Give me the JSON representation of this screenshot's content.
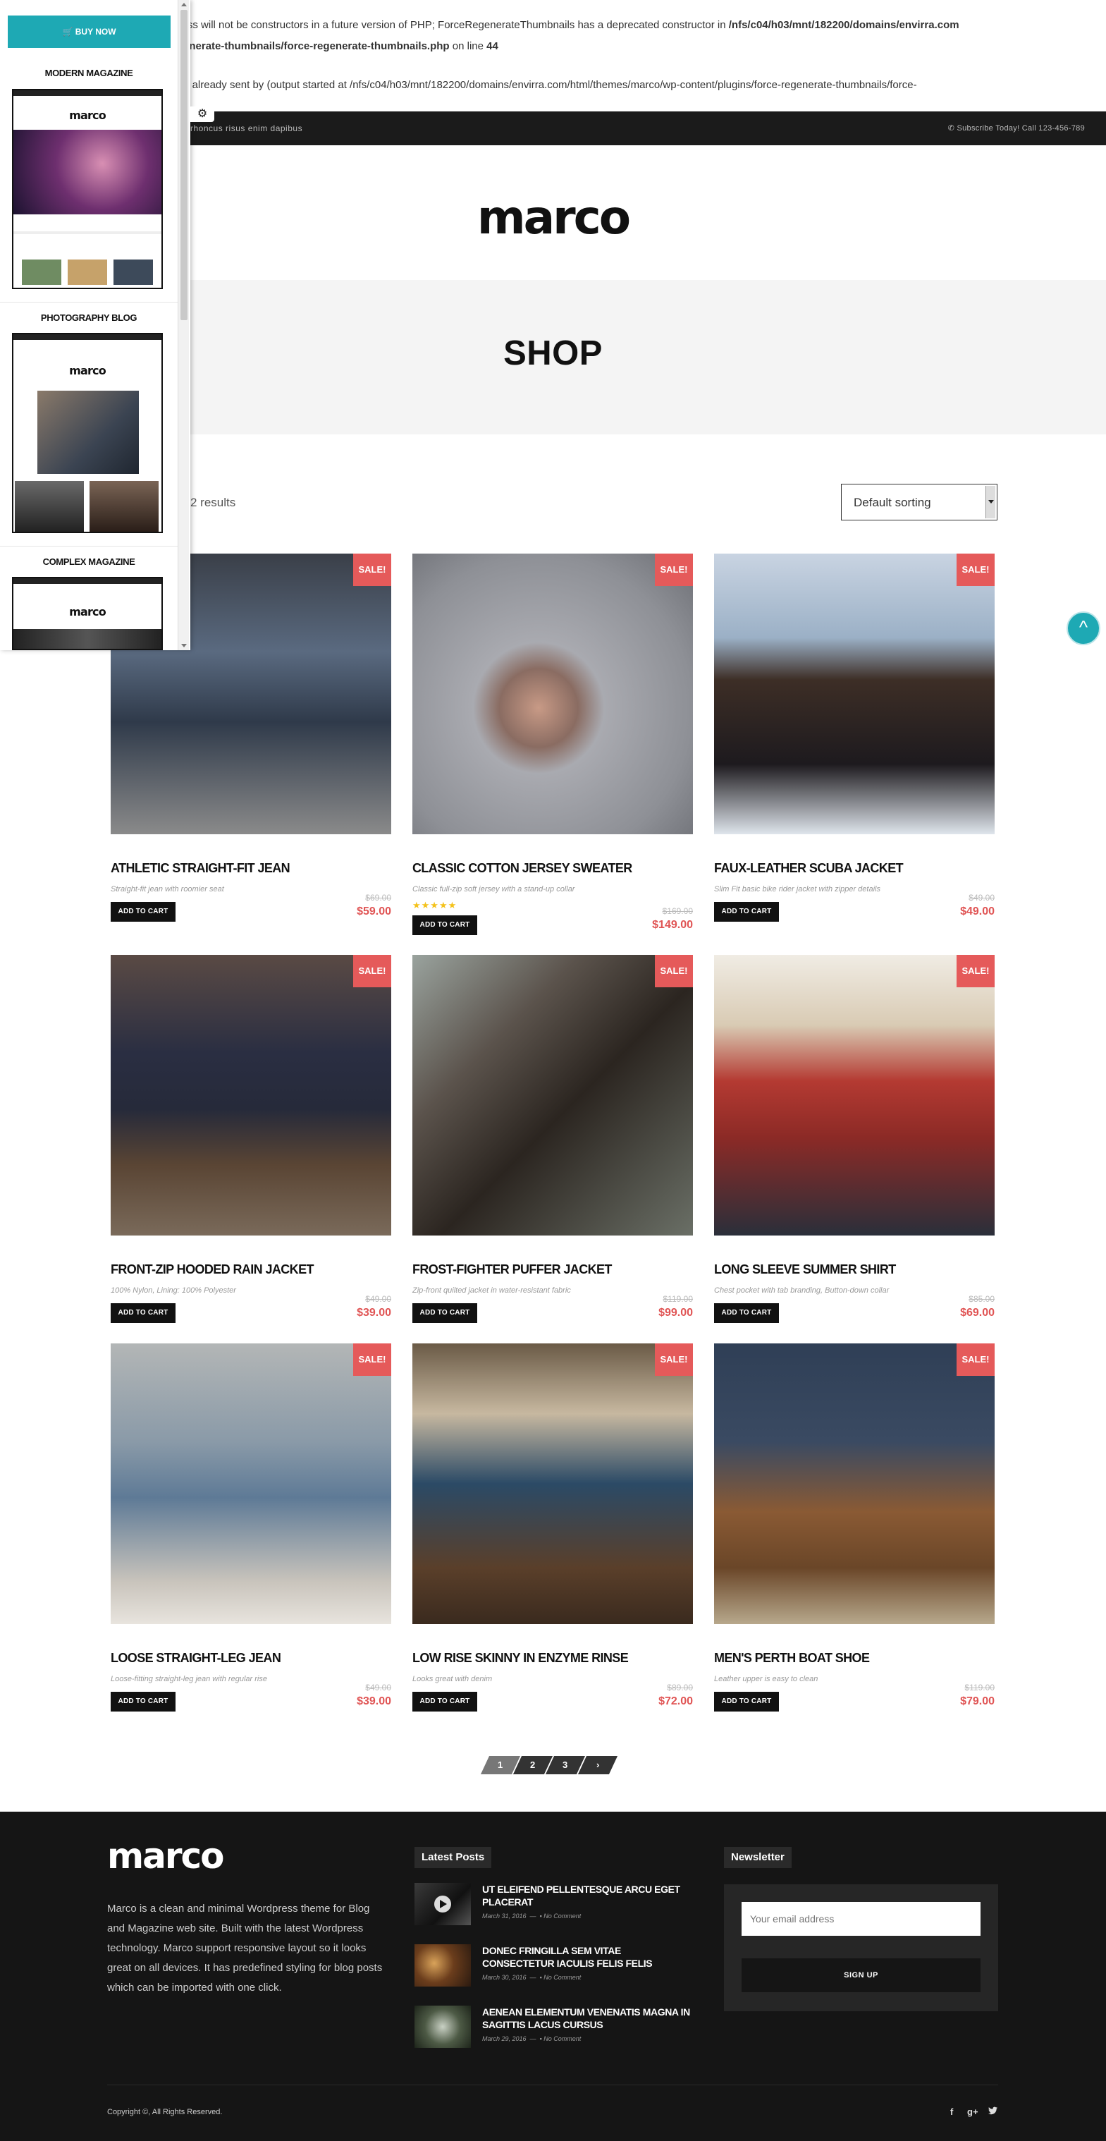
{
  "php_warning": {
    "line1": "ame as their class will not be constructors in a future version of PHP; ForceRegenerateThumbnails has a deprecated constructor in ",
    "line1_bold": "/nfs/c04/h03/mnt/182200/domains/envirra.com",
    "line2_bold": "gins/force-regenerate-thumbnails/force-regenerate-thumbnails.php",
    "line2_tail": " on line ",
    "line2_num": "44",
    "line3": "nation - headers already sent by (output started at /nfs/c04/h03/mnt/182200/domains/envirra.com/html/themes/marco/wp-content/plugins/force-regenerate-thumbnails/force-"
  },
  "topbar": {
    "tagline": "rhoncus risus enim dapibus",
    "contact": "Subscribe Today! Call 123-456-789"
  },
  "site": {
    "logo": "marco"
  },
  "page_title": "SHOP",
  "result_count": "2 results",
  "sorting": {
    "selected": "Default sorting"
  },
  "products": [
    {
      "name": "ATHLETIC STRAIGHT-FIT JEAN",
      "desc": "Straight-fit jean with roomier seat",
      "old_price": "$69.00",
      "price": "$59.00",
      "sale": "SALE!",
      "cart": "ADD TO CART"
    },
    {
      "name": "CLASSIC COTTON JERSEY SWEATER",
      "desc": "Classic full-zip soft jersey with a stand-up collar",
      "old_price": "$169.00",
      "price": "$149.00",
      "sale": "SALE!",
      "cart": "ADD TO CART",
      "stars": "★★★★★"
    },
    {
      "name": "FAUX-LEATHER SCUBA JACKET",
      "desc": "Slim Fit basic bike rider jacket with zipper details",
      "old_price": "$49.00",
      "price": "$49.00",
      "sale": "SALE!",
      "cart": "ADD TO CART"
    },
    {
      "name": "FRONT-ZIP HOODED RAIN JACKET",
      "desc": "100% Nylon, Lining: 100% Polyester",
      "old_price": "$49.00",
      "price": "$39.00",
      "sale": "SALE!",
      "cart": "ADD TO CART"
    },
    {
      "name": "FROST-FIGHTER PUFFER JACKET",
      "desc": "Zip-front quilted jacket in water-resistant fabric",
      "old_price": "$119.00",
      "price": "$99.00",
      "sale": "SALE!",
      "cart": "ADD TO CART"
    },
    {
      "name": "LONG SLEEVE SUMMER SHIRT",
      "desc": "Chest pocket with tab branding, Button-down collar",
      "old_price": "$85.00",
      "price": "$69.00",
      "sale": "SALE!",
      "cart": "ADD TO CART"
    },
    {
      "name": "LOOSE STRAIGHT-LEG JEAN",
      "desc": "Loose-fitting straight-leg jean with regular rise",
      "old_price": "$49.00",
      "price": "$39.00",
      "sale": "SALE!",
      "cart": "ADD TO CART"
    },
    {
      "name": "LOW RISE SKINNY IN ENZYME RINSE",
      "desc": "Looks great with denim",
      "old_price": "$89.00",
      "price": "$72.00",
      "sale": "SALE!",
      "cart": "ADD TO CART"
    },
    {
      "name": "MEN'S PERTH BOAT SHOE",
      "desc": "Leather upper is easy to clean",
      "old_price": "$119.00",
      "price": "$79.00",
      "sale": "SALE!",
      "cart": "ADD TO CART"
    }
  ],
  "pagination": {
    "pages": [
      "1",
      "2",
      "3"
    ],
    "next": "›"
  },
  "back_to_top": "^",
  "footer": {
    "logo": "marco",
    "about": "Marco is a clean and minimal Wordpress theme for Blog and Magazine web site. Built with the latest Wordpress technology. Marco support responsive layout so it looks great on all devices. It has predefined styling for blog posts which can be imported with one click.",
    "latest_title": "Latest Posts",
    "posts": [
      {
        "title": "UT ELEIFEND PELLENTESQUE ARCU EGET PLACERAT",
        "date": "March 31, 2016",
        "comments": "No Comment"
      },
      {
        "title": "DONEC FRINGILLA SEM VITAE CONSECTETUR IACULIS FELIS FELIS",
        "date": "March 30, 2016",
        "comments": "No Comment"
      },
      {
        "title": "AENEAN ELEMENTUM VENENATIS MAGNA IN SAGITTIS LACUS CURSUS",
        "date": "March 29, 2016",
        "comments": "No Comment"
      }
    ],
    "newsletter_title": "Newsletter",
    "email_placeholder": "Your email address",
    "signup": "SIGN UP",
    "copyright": "Copyright ©, All Rights Reserved.",
    "social": [
      "f",
      "g+",
      "t"
    ]
  },
  "panel": {
    "buy": "BUY NOW",
    "demos": [
      {
        "title": "MODERN MAGAZINE",
        "logo": "marco"
      },
      {
        "title": "PHOTOGRAPHY BLOG",
        "logo": "marco"
      },
      {
        "title": "COMPLEX MAGAZINE",
        "logo": "marco"
      }
    ]
  },
  "colors": {
    "accent": "#1ea9b4",
    "sale": "#e55a5a",
    "price": "#e05454",
    "footer_bg": "#151515"
  }
}
